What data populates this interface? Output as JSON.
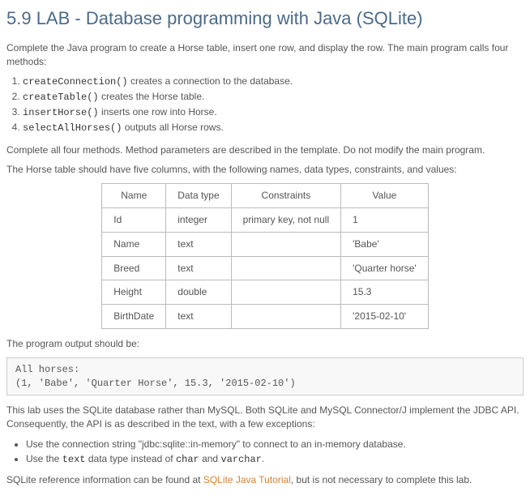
{
  "title": "5.9 LAB - Database programming with Java (SQLite)",
  "intro": "Complete the Java program to create a Horse table, insert one row, and display the row. The main program calls four methods:",
  "methods": [
    {
      "name": "createConnection()",
      "desc": " creates a connection to the database."
    },
    {
      "name": "createTable()",
      "desc": " creates the Horse table."
    },
    {
      "name": "insertHorse()",
      "desc": " inserts one row into Horse."
    },
    {
      "name": "selectAllHorses()",
      "desc": " outputs all Horse rows."
    }
  ],
  "instruction": "Complete all four methods. Method parameters are described in the template. Do not modify the main program.",
  "tableIntro": "The Horse table should have five columns, with the following names, data types, constraints, and values:",
  "schema": {
    "headers": [
      "Name",
      "Data type",
      "Constraints",
      "Value"
    ],
    "rows": [
      [
        "Id",
        "integer",
        "primary key, not null",
        "1"
      ],
      [
        "Name",
        "text",
        "",
        "'Babe'"
      ],
      [
        "Breed",
        "text",
        "",
        "'Quarter horse'"
      ],
      [
        "Height",
        "double",
        "",
        "15.3"
      ],
      [
        "BirthDate",
        "text",
        "",
        "'2015-02-10'"
      ]
    ]
  },
  "outputLabel": "The program output should be:",
  "outputText": "All horses:\n(1, 'Babe', 'Quarter Horse', 15.3, '2015-02-10')",
  "note1": "This lab uses the SQLite database rather than MySQL. Both SQLite and MySQL Connector/J implement the JDBC API. Consequently, the API is as described in the text, with a few exceptions:",
  "bullets": [
    {
      "pre": "Use the connection string \"jdbc:sqlite::in-memory\" to connect to an in-memory database."
    },
    {
      "text_pre": "Use the ",
      "code1": "text",
      "text_mid": " data type instead of ",
      "code2": "char",
      "text_mid2": " and ",
      "code3": "varchar",
      "text_end": "."
    }
  ],
  "refPre": "SQLite reference information can be found at ",
  "refLink": "SQLite Java Tutorial",
  "refPost": ", but is not necessary to complete this lab."
}
